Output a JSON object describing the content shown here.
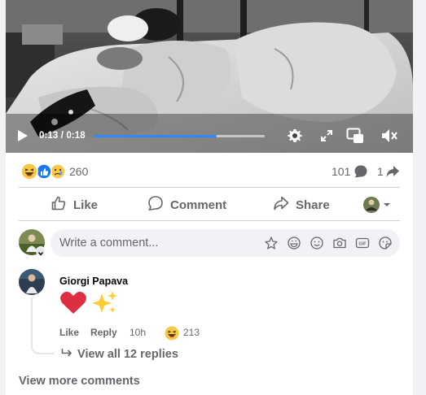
{
  "video": {
    "current_time": "0:13",
    "separator": " / ",
    "duration": "0:18",
    "progress_fraction": 0.72
  },
  "reactions": {
    "types": [
      "haha",
      "like",
      "sad"
    ],
    "count": "260",
    "comments_count": "101",
    "shares_count": "1"
  },
  "actions": {
    "like_label": "Like",
    "comment_label": "Comment",
    "share_label": "Share"
  },
  "composer": {
    "placeholder": "Write a comment...",
    "tools": [
      "avatar-sticker-icon",
      "sticker-icon",
      "emoji-icon",
      "camera-icon",
      "gif-icon",
      "sticker-face-icon"
    ]
  },
  "comment": {
    "author": "Giorgi Papava",
    "body": "❤️✨",
    "like_label": "Like",
    "reply_label": "Reply",
    "time": "10h",
    "reaction_count": "213"
  },
  "replies": {
    "view_label": "View all 12 replies"
  },
  "footer": {
    "view_more_label": "View more comments"
  },
  "colors": {
    "accent": "#2d88ff",
    "muted_text": "#65676b",
    "input_bg": "#f0f2f5"
  }
}
